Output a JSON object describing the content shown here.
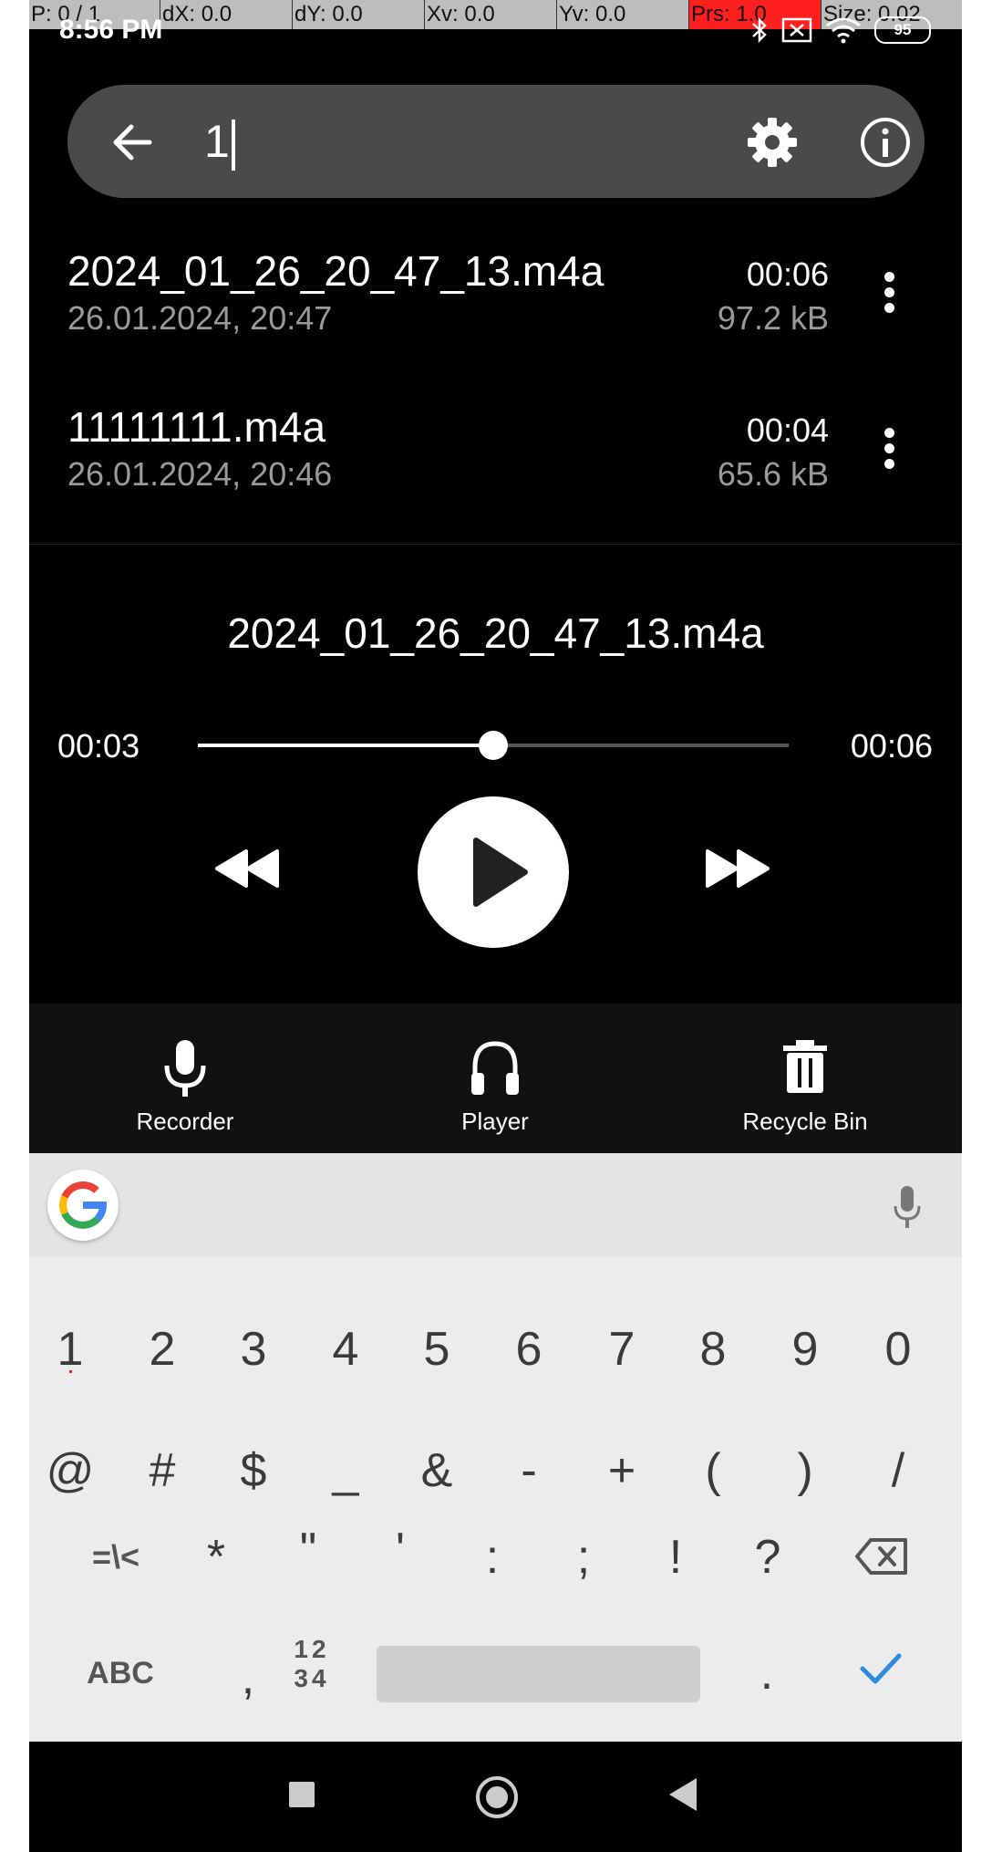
{
  "debug_bar": {
    "pointer": "P: 0 / 1",
    "dx": "dX: 0.0",
    "dy": "dY: 0.0",
    "xv": "Xv: 0.0",
    "yv": "Yv: 0.0",
    "prs": "Prs: 1.0",
    "size": "Size: 0.02"
  },
  "status_bar": {
    "time": "8:56 PM",
    "battery": "95",
    "icons": [
      "bluetooth-icon",
      "no-sim-icon",
      "wifi-icon",
      "battery-icon"
    ]
  },
  "search": {
    "value": "1",
    "icons": [
      "back-arrow-icon",
      "gear-icon",
      "info-icon"
    ]
  },
  "files": [
    {
      "name": "2024_01_26_20_47_13.m4a",
      "date": "26.01.2024, 20:47",
      "duration": "00:06",
      "size": "97.2 kB"
    },
    {
      "name": "11111111.m4a",
      "date": "26.01.2024, 20:46",
      "duration": "00:04",
      "size": "65.6 kB"
    }
  ],
  "player": {
    "title": "2024_01_26_20_47_13.m4a",
    "current_time": "00:03",
    "total_time": "00:06",
    "progress": 0.5
  },
  "nav": {
    "items": [
      {
        "label": "Recorder",
        "icon": "microphone-icon"
      },
      {
        "label": "Player",
        "icon": "headphones-icon"
      },
      {
        "label": "Recycle Bin",
        "icon": "trash-icon"
      }
    ]
  },
  "keyboard": {
    "row1": [
      "1",
      "2",
      "3",
      "4",
      "5",
      "6",
      "7",
      "8",
      "9",
      "0"
    ],
    "row2": [
      "@",
      "#",
      "$",
      "_",
      "&",
      "-",
      "+",
      "(",
      ")",
      "/"
    ],
    "row3": [
      "=\\<",
      "*",
      "\"",
      "'",
      ":",
      ";",
      "!",
      "?"
    ],
    "abc": "ABC",
    "comma": ",",
    "numpad_top": "12",
    "numpad_bottom": "34",
    "period": "."
  },
  "colors": {
    "background": "#000000",
    "search_bg": "#4a4a4a",
    "nav_bg": "#111111",
    "keyboard_bg": "#ececec",
    "accent_check": "#2e8be0"
  }
}
